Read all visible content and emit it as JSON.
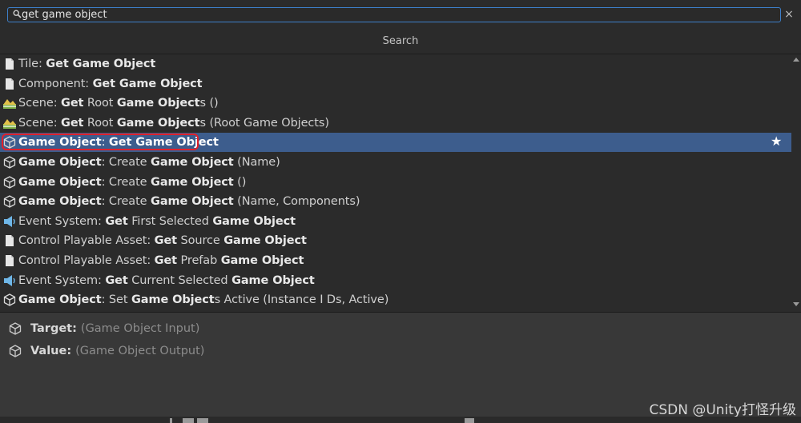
{
  "search": {
    "value": "get game object",
    "clear_glyph": "×",
    "icon": "search-icon"
  },
  "header": {
    "title": "Search"
  },
  "results": [
    {
      "icon": "document-icon",
      "parts": [
        [
          "Tile: ",
          false
        ],
        [
          "Get Game Object",
          true
        ]
      ]
    },
    {
      "icon": "document-icon",
      "parts": [
        [
          "Component: ",
          false
        ],
        [
          "Get Game Object",
          true
        ]
      ]
    },
    {
      "icon": "scene-icon",
      "parts": [
        [
          "Scene: ",
          false
        ],
        [
          "Get",
          true
        ],
        [
          " Root ",
          false
        ],
        [
          "Game Object",
          true
        ],
        [
          "s ()",
          false
        ]
      ]
    },
    {
      "icon": "scene-icon",
      "parts": [
        [
          "Scene: ",
          false
        ],
        [
          "Get",
          true
        ],
        [
          " Root ",
          false
        ],
        [
          "Game Object",
          true
        ],
        [
          "s (Root Game Objects)",
          false
        ]
      ]
    },
    {
      "icon": "cube-icon",
      "parts": [
        [
          "Game Object",
          true
        ],
        [
          ": ",
          false
        ],
        [
          "Get Game Object",
          true
        ]
      ],
      "selected": true,
      "favorite": true
    },
    {
      "icon": "cube-icon",
      "parts": [
        [
          "Game Object",
          true
        ],
        [
          ": Create ",
          false
        ],
        [
          "Game Object",
          true
        ],
        [
          " (Name)",
          false
        ]
      ]
    },
    {
      "icon": "cube-icon",
      "parts": [
        [
          "Game Object",
          true
        ],
        [
          ": Create ",
          false
        ],
        [
          "Game Object",
          true
        ],
        [
          " ()",
          false
        ]
      ]
    },
    {
      "icon": "cube-icon",
      "parts": [
        [
          "Game Object",
          true
        ],
        [
          ": Create ",
          false
        ],
        [
          "Game Object",
          true
        ],
        [
          " (Name, Components)",
          false
        ]
      ]
    },
    {
      "icon": "event-system-icon",
      "parts": [
        [
          "Event System: ",
          false
        ],
        [
          "Get",
          true
        ],
        [
          " First Selected ",
          false
        ],
        [
          "Game Object",
          true
        ]
      ]
    },
    {
      "icon": "document-icon",
      "parts": [
        [
          "Control Playable Asset: ",
          false
        ],
        [
          "Get",
          true
        ],
        [
          " Source ",
          false
        ],
        [
          "Game Object",
          true
        ]
      ]
    },
    {
      "icon": "document-icon",
      "parts": [
        [
          "Control Playable Asset: ",
          false
        ],
        [
          "Get",
          true
        ],
        [
          " Prefab ",
          false
        ],
        [
          "Game Object",
          true
        ]
      ]
    },
    {
      "icon": "event-system-icon",
      "parts": [
        [
          "Event System: ",
          false
        ],
        [
          "Get",
          true
        ],
        [
          " Current Selected ",
          false
        ],
        [
          "Game Object",
          true
        ]
      ]
    },
    {
      "icon": "cube-icon",
      "parts": [
        [
          "Game Object",
          true
        ],
        [
          ": Set ",
          false
        ],
        [
          "Game Object",
          true
        ],
        [
          "s Active (Instance I Ds, Active)",
          false
        ]
      ]
    }
  ],
  "favorite_glyph": "★",
  "details": {
    "target": {
      "key": "Target:",
      "value": "(Game Object Input)"
    },
    "value": {
      "key": "Value:",
      "value": "(Game Object Output)"
    }
  },
  "watermark": "CSDN @Unity打怪升级",
  "colors": {
    "selection": "#3d5d8d",
    "highlight_border": "#e0202a",
    "search_focus": "#3d7fc9"
  }
}
